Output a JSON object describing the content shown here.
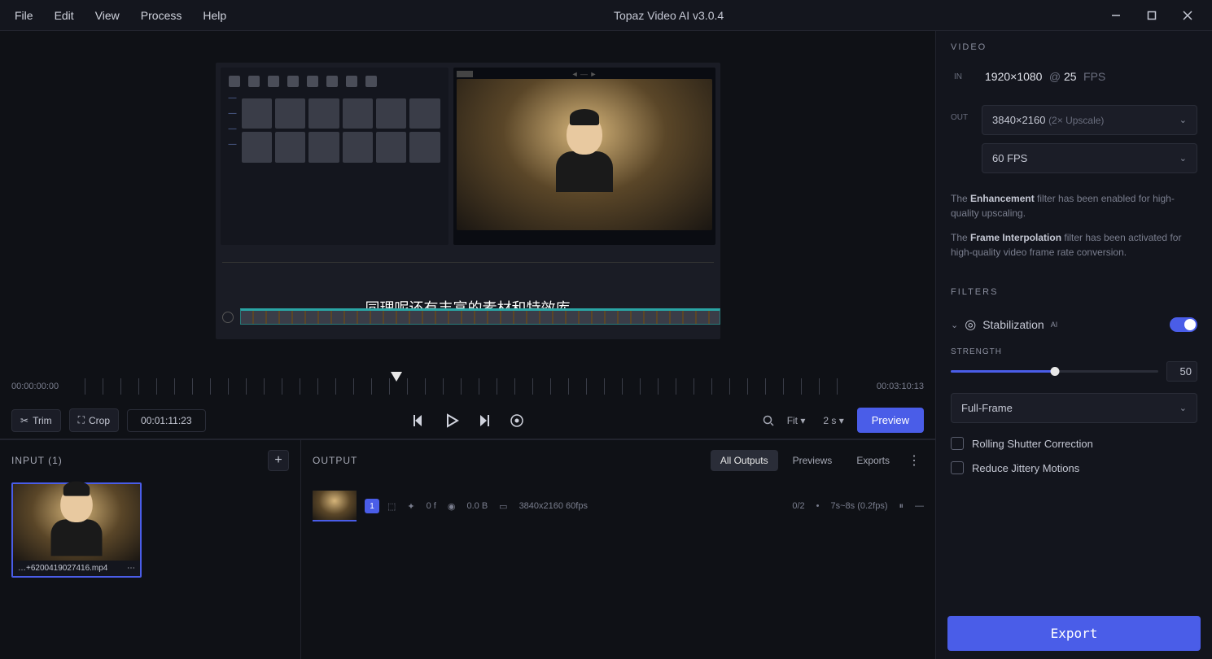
{
  "app": {
    "title": "Topaz Video AI  v3.0.4"
  },
  "menu": [
    "File",
    "Edit",
    "View",
    "Process",
    "Help"
  ],
  "preview": {
    "subtitle": "同理呢还有丰富的素材和特效库"
  },
  "timeline": {
    "start_time": "00:00:00:00",
    "end_time": "00:03:10:13",
    "current_time": "00:01:11:23"
  },
  "controls": {
    "trim": "Trim",
    "crop": "Crop",
    "fit": "Fit ▾",
    "zoom": "2 s ▾",
    "preview": "Preview"
  },
  "input_panel": {
    "title": "INPUT (1)",
    "file_name": "…+6200419027416.mp4"
  },
  "output_panel": {
    "title": "OUTPUT",
    "tabs": {
      "all": "All Outputs",
      "previews": "Previews",
      "exports": "Exports"
    },
    "row": {
      "badge": "1",
      "meta1": "0 f",
      "meta2": "0.0 B",
      "res": "3840x2160  60fps",
      "progress": "0/2",
      "speed": "7s~8s (0.2fps)"
    }
  },
  "side": {
    "video_heading": "VIDEO",
    "in_label": "IN",
    "out_label": "OUT",
    "in_res": "1920×1080",
    "in_fps": "25",
    "in_fps_unit": "FPS",
    "out_res_sel": "3840×2160",
    "out_res_hint": "(2× Upscale)",
    "out_fps_sel": "60 FPS",
    "info1_pre": "The ",
    "info1_bold": "Enhancement",
    "info1_post": " filter has been enabled for high-quality upscaling.",
    "info2_pre": "The ",
    "info2_bold": "Frame Interpolation",
    "info2_post": " filter has been activated for high-quality video frame rate conversion.",
    "filters_heading": "FILTERS",
    "stabilization": "Stabilization",
    "stab_badge": "AI",
    "strength_label": "STRENGTH",
    "strength_value": "50",
    "mode_sel": "Full-Frame",
    "check1": "Rolling Shutter Correction",
    "check2": "Reduce Jittery Motions",
    "export": "Export"
  }
}
